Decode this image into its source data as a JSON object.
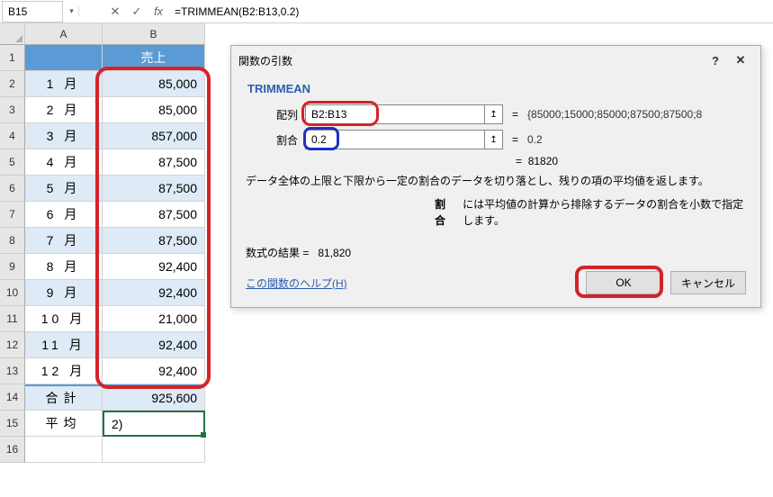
{
  "name_box": "B15",
  "formula": "=TRIMMEAN(B2:B13,0.2)",
  "columns": [
    "A",
    "B"
  ],
  "header_row": {
    "A": "",
    "B": "売上"
  },
  "rows": [
    {
      "n": 1
    },
    {
      "n": 2,
      "A": "1 月",
      "B": "85,000",
      "band": true
    },
    {
      "n": 3,
      "A": "2 月",
      "B": "85,000",
      "band": false
    },
    {
      "n": 4,
      "A": "3 月",
      "B": "857,000",
      "band": true
    },
    {
      "n": 5,
      "A": "4 月",
      "B": "87,500",
      "band": false
    },
    {
      "n": 6,
      "A": "5 月",
      "B": "87,500",
      "band": true
    },
    {
      "n": 7,
      "A": "6 月",
      "B": "87,500",
      "band": false
    },
    {
      "n": 8,
      "A": "7 月",
      "B": "87,500",
      "band": true
    },
    {
      "n": 9,
      "A": "8 月",
      "B": "92,400",
      "band": false
    },
    {
      "n": 10,
      "A": "9 月",
      "B": "92,400",
      "band": true
    },
    {
      "n": 11,
      "A": "10 月",
      "B": "21,000",
      "band": false
    },
    {
      "n": 12,
      "A": "11 月",
      "B": "92,400",
      "band": true
    },
    {
      "n": 13,
      "A": "12 月",
      "B": "92,400",
      "band": false
    }
  ],
  "total_row": {
    "n": 14,
    "A": "合計",
    "B": "925,600"
  },
  "average_row": {
    "n": 15,
    "A": "平均",
    "B": "2)"
  },
  "empty_row": {
    "n": 16
  },
  "dialog": {
    "title": "関数の引数",
    "func": "TRIMMEAN",
    "args": [
      {
        "label": "配列",
        "value": "B2:B13",
        "result": "{85000;15000;85000;87500;87500;8"
      },
      {
        "label": "割合",
        "value": "0.2",
        "result": "0.2"
      }
    ],
    "calc_value": "81820",
    "desc_main": "データ全体の上限と下限から一定の割合のデータを切り落とし、残りの項の平均値を返します。",
    "desc_arg_name": "割合",
    "desc_arg_text": "には平均値の計算から排除するデータの割合を小数で指定します。",
    "result_label": "数式の結果 =",
    "result_value": "81,820",
    "help_link": "この関数のヘルプ(H)",
    "ok": "OK",
    "cancel": "キャンセル"
  },
  "icons": {
    "dropdown": "▾",
    "cancel_x": "✕",
    "check": "✓",
    "help_q": "?",
    "arrow_up": "↥"
  }
}
